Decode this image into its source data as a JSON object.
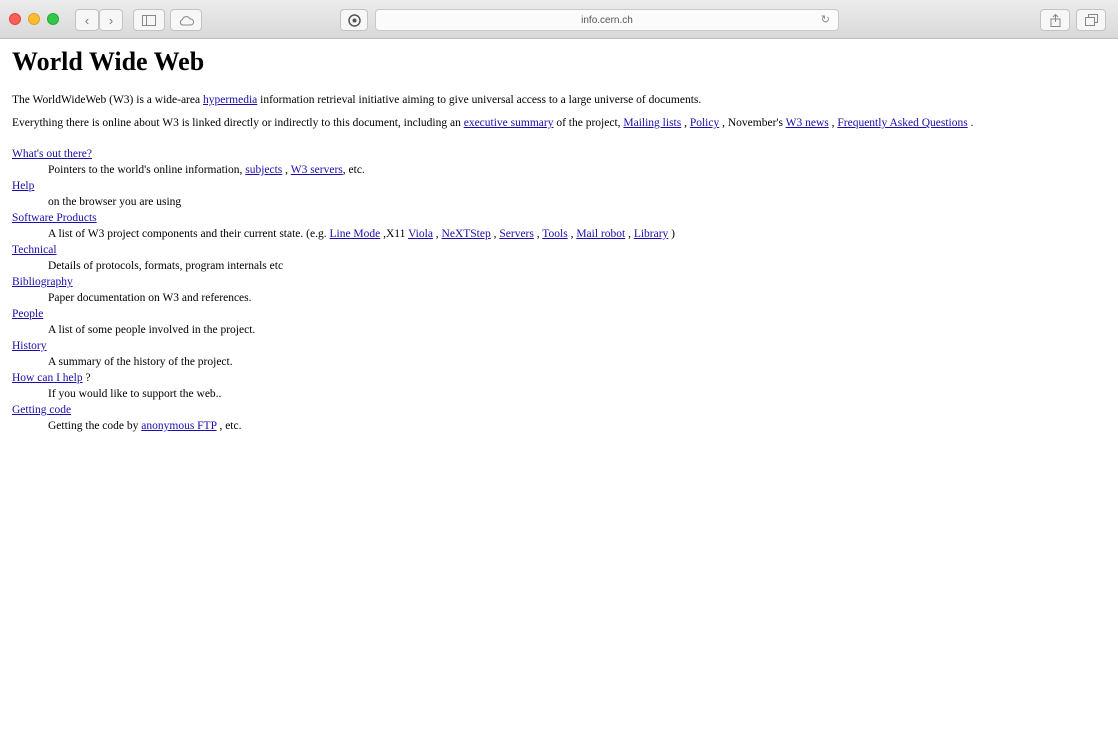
{
  "browser": {
    "url": "info.cern.ch"
  },
  "page": {
    "title": "World Wide Web",
    "intro": {
      "before": "The WorldWideWeb (W3) is a wide-area",
      "link": "hypermedia",
      "after": "information retrieval initiative aiming to give universal access to a large universe of documents."
    },
    "overview": {
      "text1": "Everything there is online about W3 is linked directly or indirectly to this document, including an",
      "link_summary": "executive summary",
      "text2": "of the project,",
      "link_mailing": "Mailing lists",
      "text3": ",",
      "link_policy": "Policy",
      "text4": ", November's",
      "link_news": "W3 news",
      "text5": ",",
      "link_faq": "Frequently Asked Questions",
      "text6": "."
    },
    "sections": {
      "whats_out": {
        "term": "What's out there?",
        "d1": "Pointers to the world's online information,",
        "l1": "subjects",
        "d2": ",",
        "l2": "W3 servers",
        "d3": ", etc."
      },
      "help": {
        "term": "Help",
        "desc": "on the browser you are using"
      },
      "software": {
        "term": "Software Products",
        "d1": "A list of W3 project components and their current state. (e.g.",
        "l_linemode": "Line Mode",
        "d2": ",X11",
        "l_viola": "Viola",
        "d3": ",",
        "l_nextstep": "NeXTStep",
        "d4": ",",
        "l_servers": "Servers",
        "d5": ",",
        "l_tools": "Tools",
        "d6": ",",
        "l_mailrobot": "Mail robot",
        "d7": ",",
        "l_library": "Library",
        "d8": ")"
      },
      "technical": {
        "term": "Technical",
        "desc": "Details of protocols, formats, program internals etc"
      },
      "bibliography": {
        "term": "Bibliography",
        "desc": "Paper documentation on W3 and references."
      },
      "people": {
        "term": "People",
        "desc": "A list of some people involved in the project."
      },
      "history": {
        "term": "History",
        "desc": "A summary of the history of the project."
      },
      "howcan": {
        "term": "How can I help",
        "after": "?",
        "desc": "If you would like to support the web.."
      },
      "code": {
        "term": "Getting code",
        "d1": "Getting the code by",
        "l1": "anonymous FTP",
        "d2": ", etc."
      }
    }
  }
}
